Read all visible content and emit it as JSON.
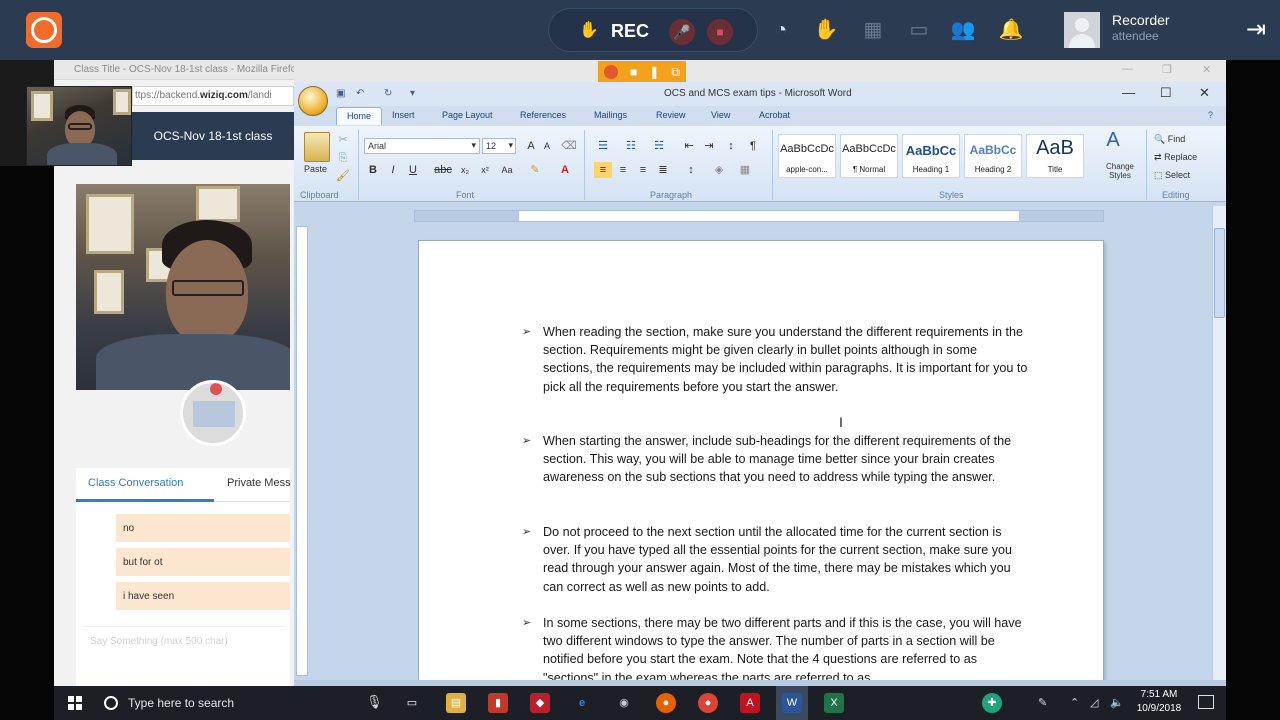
{
  "topbar": {
    "rec_label": "REC",
    "user_name": "Recorder",
    "user_role": "attendee",
    "icons": [
      "logo-icon",
      "hand-icon",
      "mic-muted-icon",
      "camera-muted-icon",
      "timer-icon",
      "raise-hand-icon",
      "content-icon",
      "screen-icon",
      "participants-icon",
      "bell-icon",
      "exit-icon"
    ]
  },
  "browser": {
    "window_title": "Class Title - OCS-Nov 18-1st class - Mozilla Firefox",
    "url_prefix": "ttps://backend.",
    "url_domain": "wiziq.com",
    "url_suffix": "/landi"
  },
  "sidebar": {
    "class_title": "OCS-Nov 18-1st class",
    "tabs": [
      {
        "label": "Class Conversation",
        "active": true
      },
      {
        "label": "Private Mess",
        "active": false
      }
    ],
    "messages": [
      "no",
      "but for ot",
      "i have seen"
    ],
    "input_placeholder": "Say Something (max 500 char)"
  },
  "word": {
    "title": "OCS and MCS exam tips - Microsoft Word",
    "ribbon_tabs": [
      "Home",
      "Insert",
      "Page Layout",
      "References",
      "Mailings",
      "Review",
      "View",
      "Acrobat"
    ],
    "active_tab": "Home",
    "font_name": "Arial",
    "font_size": "12",
    "groups": [
      "Clipboard",
      "Font",
      "Paragraph",
      "Styles",
      "Editing"
    ],
    "paste_label": "Paste",
    "styles": [
      {
        "sample": "AaBbCcDc",
        "name": "apple-con..."
      },
      {
        "sample": "AaBbCcDc",
        "name": "¶ Normal"
      },
      {
        "sample": "AaBbCc",
        "name": "Heading 1"
      },
      {
        "sample": "AaBbCc",
        "name": "Heading 2"
      },
      {
        "sample": "AaB",
        "name": "Title"
      }
    ],
    "change_styles": "Change Styles",
    "editing": [
      "Find",
      "Replace",
      "Select"
    ],
    "paragraphs": [
      "When reading the section, make sure you understand the different requirements in the section. Requirements might be given clearly in bullet points although in some sections, the requirements may be included within paragraphs. It is important for you to pick all the requirements before you start the answer.",
      "When starting the answer, include sub-headings for the different requirements of the section. This way, you will be able to manage time better since your brain creates awareness on the sub sections that you need to address while typing the answer.",
      "Do not proceed to the next section until the allocated time for the current section is over. If you have typed all the essential points for the current section, make sure you read through your answer again. Most of the time, there may be mistakes which you can correct as well as new points to add.",
      "In some sections, there may be two different parts and if this is the case, you will have two different windows to type the answer. The number of parts in a section will be notified before you start the exam. Note that the 4 questions are referred to as \"sections\" in the exam whereas the parts are referred to as"
    ]
  },
  "taskbar": {
    "search_text": "Type here to search",
    "time": "7:51 AM",
    "date": "10/9/2018"
  }
}
